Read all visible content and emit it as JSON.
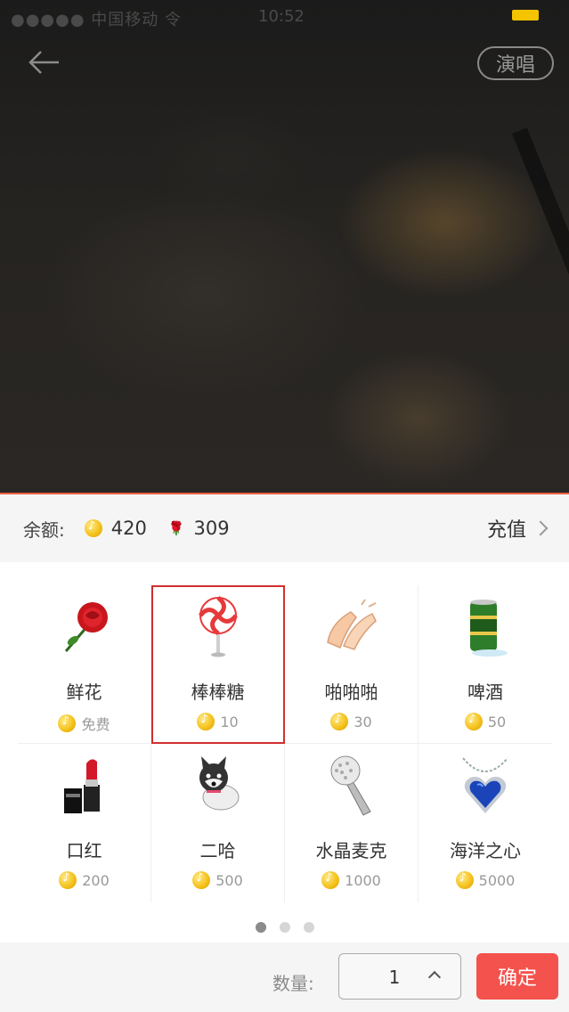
{
  "status": {
    "left": "●●●●● 中国移动 令",
    "time": "10:52"
  },
  "header": {
    "back_icon": "arrow-left-icon",
    "sing_label": "演唱"
  },
  "balance": {
    "label": "余额:",
    "coins": "420",
    "flowers": "309",
    "recharge_label": "充值"
  },
  "gifts": [
    {
      "name": "鲜花",
      "price": "免费",
      "icon": "rose-icon"
    },
    {
      "name": "棒棒糖",
      "price": "10",
      "icon": "lollipop-icon",
      "selected": true
    },
    {
      "name": "啪啪啪",
      "price": "30",
      "icon": "clapping-hands-icon"
    },
    {
      "name": "啤酒",
      "price": "50",
      "icon": "beer-can-icon"
    },
    {
      "name": "口红",
      "price": "200",
      "icon": "lipstick-icon"
    },
    {
      "name": "二哈",
      "price": "500",
      "icon": "husky-dog-icon"
    },
    {
      "name": "水晶麦克",
      "price": "1000",
      "icon": "crystal-microphone-icon"
    },
    {
      "name": "海洋之心",
      "price": "5000",
      "icon": "heart-necklace-icon"
    }
  ],
  "pager": {
    "pages": 3,
    "active": 1
  },
  "quantity": {
    "label": "数量:",
    "value": "1"
  },
  "confirm_label": "确定",
  "colors": {
    "accent": "#f4524d",
    "selection": "#d32f2f",
    "coin": "#f5c31c"
  }
}
